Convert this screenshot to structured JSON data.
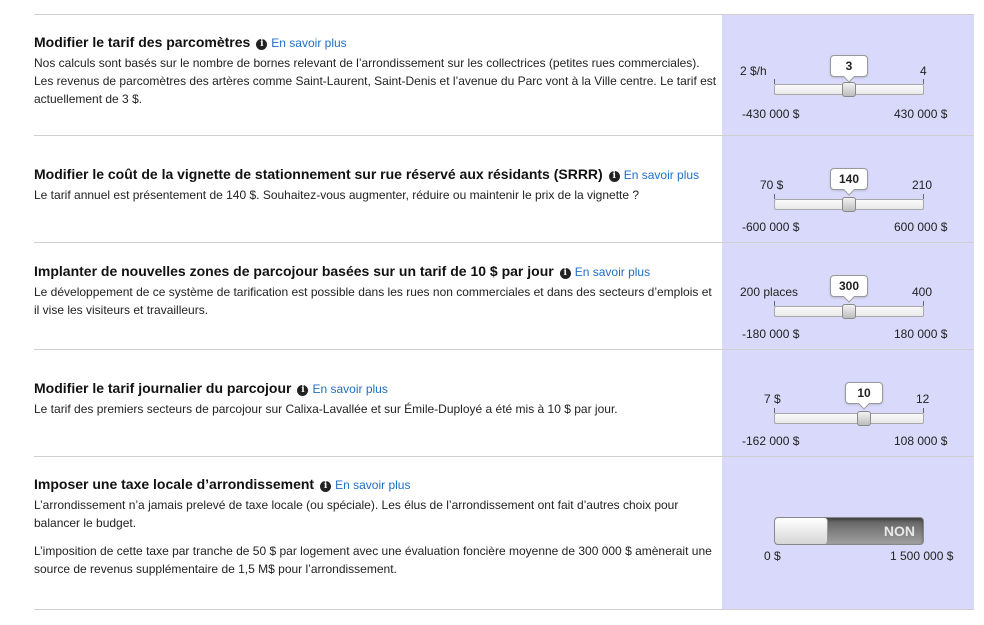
{
  "info_glyph": "i",
  "link_label": "En savoir plus",
  "rows": [
    {
      "title": "Modifier le tarif des parcomètres",
      "desc": [
        "Nos calculs sont basés sur le nombre de bornes relevant de l’arrondissement sur les collectrices (petites rues commerciales). Les revenus de parcomètres des artères comme Saint-Laurent, Saint-Denis et l’avenue du Parc vont à la Ville centre. Le tarif est actuellement de 3 $."
      ],
      "min_label": "2 $/h",
      "max_label": "4",
      "value": "3",
      "value_fraction": 0.5,
      "impact_min": "-430 000 $",
      "impact_max": "430 000 $"
    },
    {
      "title": "Modifier le coût de la vignette de stationnement sur rue réservé aux résidants (SRRR)",
      "desc": [
        "Le tarif annuel est présentement de 140 $. Souhaitez-vous augmenter, réduire ou maintenir le prix de la vignette ?"
      ],
      "min_label": "70 $",
      "max_label": "210",
      "value": "140",
      "value_fraction": 0.5,
      "impact_min": "-600 000 $",
      "impact_max": "600 000 $"
    },
    {
      "title": "Implanter de nouvelles zones de parcojour basées sur un tarif de 10 $ par jour",
      "desc": [
        "Le développement de ce système de tarification est possible dans les rues non commerciales et dans des secteurs d’emplois et il vise les visiteurs et travailleurs."
      ],
      "min_label": "200 places",
      "max_label": "400",
      "value": "300",
      "value_fraction": 0.5,
      "impact_min": "-180 000 $",
      "impact_max": "180 000 $"
    },
    {
      "title": "Modifier le tarif journalier du parcojour",
      "desc": [
        "Le tarif des premiers secteurs de parcojour sur Calixa-Lavallée et sur Émile-Duployé a été mis à 10 $ par jour."
      ],
      "min_label": "7 $",
      "max_label": "12",
      "value": "10",
      "value_fraction": 0.6,
      "impact_min": "-162 000 $",
      "impact_max": "108 000 $"
    },
    {
      "title": "Imposer une taxe locale d’arrondissement",
      "desc": [
        "L’arrondissement n’a jamais prelevé de taxe locale (ou spéciale). Les élus de l’arrondissement ont fait d’autres choix pour balancer le budget.",
        "L’imposition de cette taxe par tranche de 50 $ par logement avec une évaluation foncière moyenne de 300 000 $ amènerait une source de revenus supplémentaire de 1,5 M$ pour l’arrondissement."
      ],
      "toggle_state": "NON",
      "impact_min": "0 $",
      "impact_max": "1 500 000 $"
    }
  ]
}
